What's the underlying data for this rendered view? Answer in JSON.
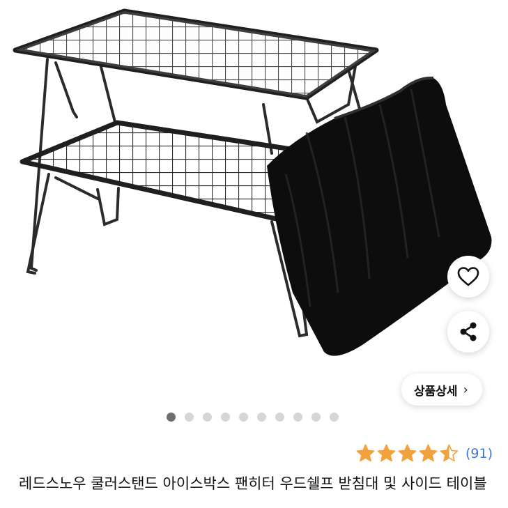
{
  "product": {
    "title": "레드스노우 쿨러스탠드 아이스박스 팬히터 우드쉘프 받침대 및 사이드 테이블",
    "rating_value": 4.5,
    "rating_max": 5,
    "review_count": "(91)"
  },
  "gallery": {
    "image_count": 10,
    "active_index": 0,
    "detail_button_label": "상품상세",
    "detail_button_chevron": "›"
  },
  "actions": {
    "wishlist_icon": "heart-icon",
    "share_icon": "share-icon"
  },
  "colors": {
    "star": "#F2A23C",
    "review_count": "#3F73D8",
    "dot_active": "#6E6E6E",
    "dot_inactive": "#D6D6D6"
  }
}
